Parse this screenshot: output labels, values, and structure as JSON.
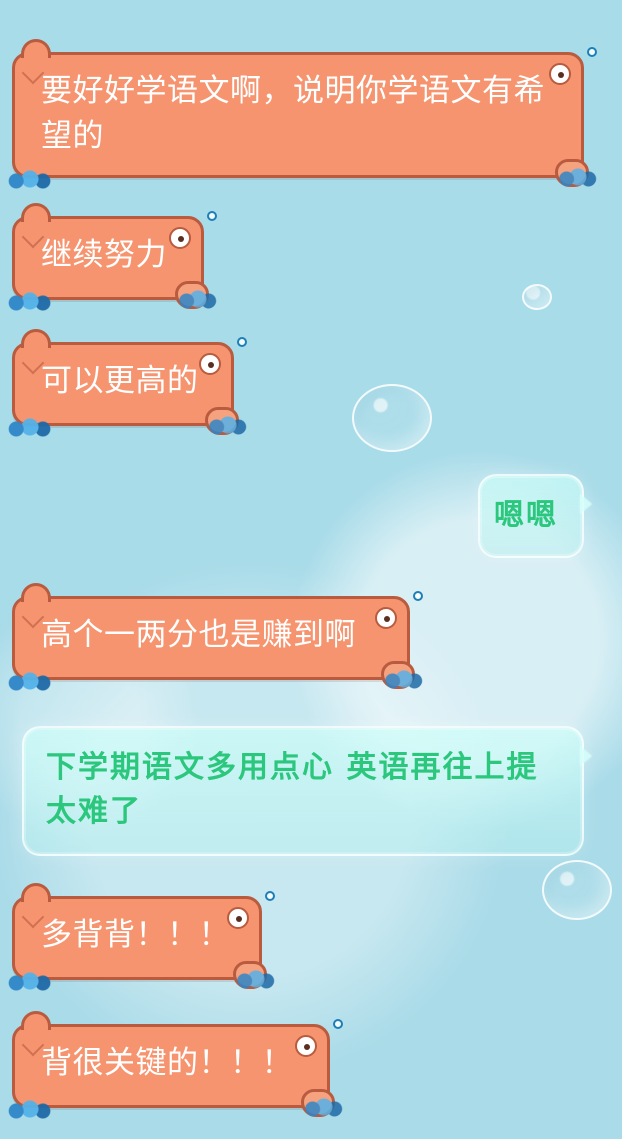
{
  "messages": [
    {
      "side": "left",
      "style": "fish",
      "text": "要好好学语文啊，说明你学语文有希望的"
    },
    {
      "side": "left",
      "style": "fish",
      "text": "继续努力"
    },
    {
      "side": "left",
      "style": "fish",
      "text": "可以更高的"
    },
    {
      "side": "right",
      "style": "glass",
      "text": "嗯嗯"
    },
    {
      "side": "left",
      "style": "fish",
      "text": "高个一两分也是赚到啊"
    },
    {
      "side": "right",
      "style": "glass",
      "text": "下学期语文多用点心 英语再往上提太难了"
    },
    {
      "side": "left",
      "style": "fish",
      "text": "多背背！！！"
    },
    {
      "side": "left",
      "style": "fish",
      "text": "背很关键的！！！"
    }
  ],
  "colors": {
    "background": "#a9dbe8",
    "fish_fill": "#f6946f",
    "fish_border": "#b85b3f",
    "glass_text": "#2bc77d"
  }
}
